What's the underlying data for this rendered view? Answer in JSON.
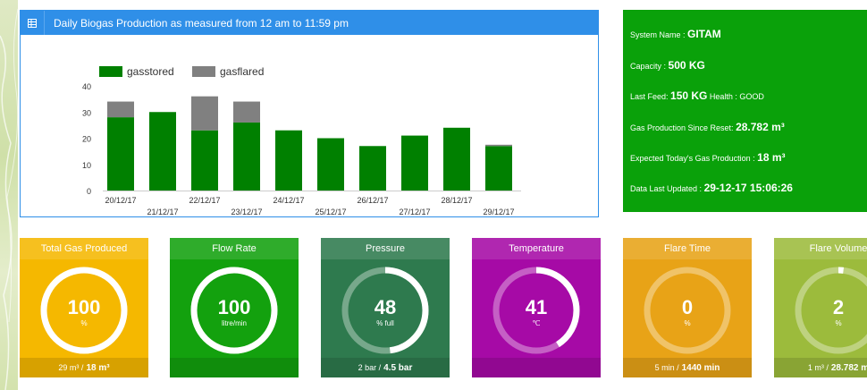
{
  "chart": {
    "header_title": "Daily Biogas Production as measured from 12 am to 11:59 pm",
    "header_icon": "table-icon",
    "chart_data": {
      "type": "bar",
      "stacked": true,
      "categories": [
        "20/12/17",
        "21/12/17",
        "22/12/17",
        "23/12/17",
        "24/12/17",
        "25/12/17",
        "26/12/17",
        "27/12/17",
        "28/12/17",
        "29/12/17"
      ],
      "series": [
        {
          "name": "gasstored",
          "color": "#008000",
          "values": [
            28,
            30,
            23,
            26,
            23,
            20,
            17,
            21,
            24,
            17
          ]
        },
        {
          "name": "gasflared",
          "color": "#808080",
          "values": [
            6,
            0,
            13,
            8,
            0,
            0,
            0,
            0,
            0,
            0.5
          ]
        }
      ],
      "yticks": [
        0,
        10,
        20,
        30,
        40
      ],
      "ylim": [
        0,
        40
      ],
      "legend": "top-left"
    }
  },
  "info": {
    "system_name_label": "System Name : ",
    "system_name": "GITAM",
    "capacity_label": "Capacity : ",
    "capacity": "500 KG",
    "last_feed_label": "Last Feed: ",
    "last_feed": "150 KG",
    "health_label": " Health : ",
    "health": "GOOD",
    "gas_since_reset_label": "Gas Production Since Reset: ",
    "gas_since_reset": "28.782 m³",
    "expected_today_label": "Expected Today's Gas Production : ",
    "expected_today": "18 m³",
    "last_updated_label": "Data Last Updated : ",
    "last_updated": "29-12-17 15:06:26"
  },
  "tiles": [
    {
      "title": "Total Gas Produced",
      "value": "100",
      "unit": "%",
      "fraction": 1.0,
      "foot_small": "29 m³ / ",
      "foot_bold": "18 m³",
      "color": "#f5b800"
    },
    {
      "title": "Flow Rate",
      "value": "100",
      "unit": "litre/min",
      "fraction": 1.0,
      "foot_small": "",
      "foot_bold": "",
      "color": "#13a10e"
    },
    {
      "title": "Pressure",
      "value": "48",
      "unit": "% full",
      "fraction": 0.48,
      "foot_small": "2 bar / ",
      "foot_bold": "4.5 bar",
      "color": "#2e7a4e"
    },
    {
      "title": "Temperature",
      "value": "41",
      "unit": "℃",
      "fraction": 0.41,
      "foot_small": "",
      "foot_bold": "",
      "color": "#a60aa6"
    },
    {
      "title": "Flare Time",
      "value": "0",
      "unit": "%",
      "fraction": 0.0,
      "foot_small": "5 min / ",
      "foot_bold": "1440 min",
      "color": "#e8a317"
    },
    {
      "title": "Flare Volume",
      "value": "2",
      "unit": "%",
      "fraction": 0.02,
      "foot_small": "1 m³ / ",
      "foot_bold": "28.782 m",
      "color": "#9cbb3c"
    }
  ]
}
